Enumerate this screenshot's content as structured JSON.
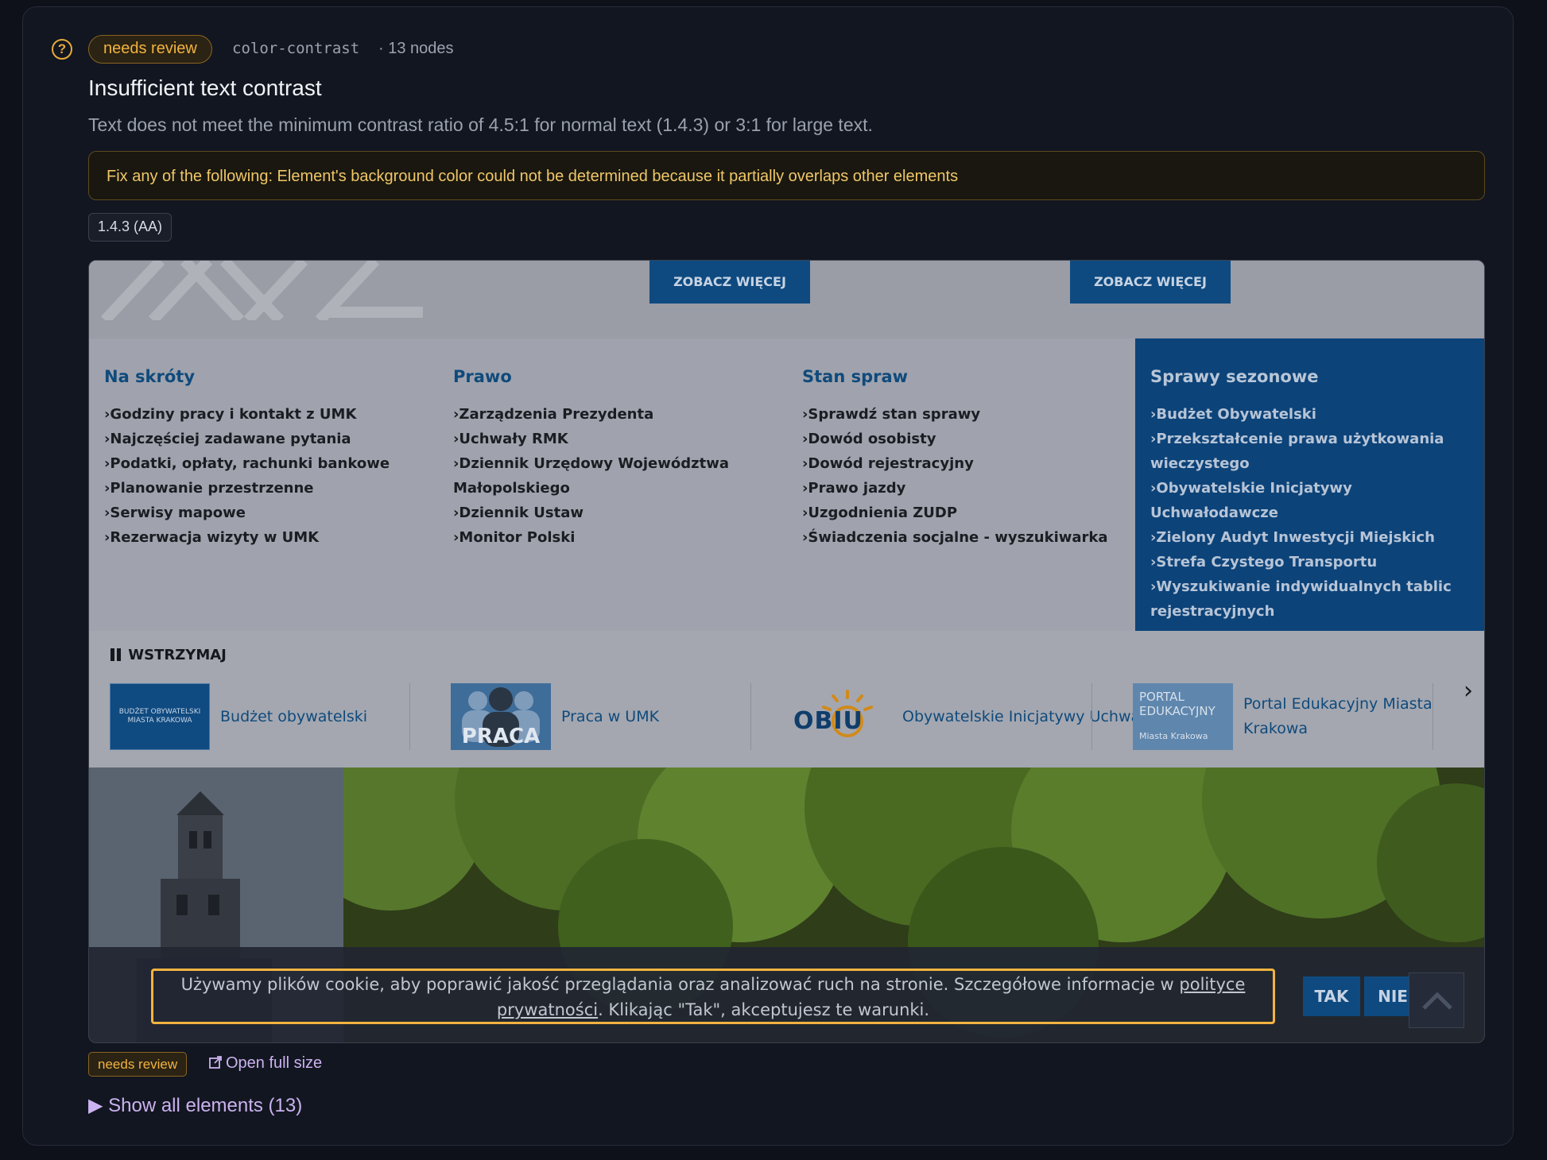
{
  "issue": {
    "status": "needs review",
    "rule_id": "color-contrast",
    "node_count": "· 13 nodes",
    "title": "Insufficient text contrast",
    "description": "Text does not meet the minimum contrast ratio of 4.5:1 for normal text (1.4.3) or 3:1 for large text.",
    "fix_message": "Fix any of the following: Element's background color could not be determined because it partially overlaps other elements",
    "wcag_tag": "1.4.3 (AA)"
  },
  "screenshot": {
    "top_buttons": [
      "ZOBACZ WIĘCEJ",
      "ZOBACZ WIĘCEJ"
    ],
    "columns": [
      {
        "heading": "Na skróty",
        "items": [
          "Godziny pracy i kontakt z UMK",
          "Najczęściej zadawane pytania",
          "Podatki, opłaty, rachunki bankowe",
          "Planowanie przestrzenne",
          "Serwisy mapowe",
          "Rezerwacja wizyty w UMK"
        ]
      },
      {
        "heading": "Prawo",
        "items": [
          "Zarządzenia Prezydenta",
          "Uchwały RMK",
          "Dziennik Urzędowy Województwa Małopolskiego",
          "Dziennik Ustaw",
          "Monitor Polski"
        ]
      },
      {
        "heading": "Stan spraw",
        "items": [
          "Sprawdź stan sprawy",
          "Dowód osobisty",
          "Dowód rejestracyjny",
          "Prawo jazdy",
          "Uzgodnienia ZUDP",
          "Świadczenia socjalne - wyszukiwarka"
        ]
      }
    ],
    "seasonal": {
      "heading": "Sprawy sezonowe",
      "items": [
        "Budżet Obywatelski",
        "Przekształcenie prawa użytkowania wieczystego",
        "Obywatelskie Inicjatywy Uchwałodawcze",
        "Zielony Audyt Inwestycji Miejskich",
        "Strefa Czystego Transportu",
        "Wyszukiwanie indywidualnych tablic rejestracyjnych"
      ]
    },
    "carousel": {
      "pause_label": "WSTRZYMAJ",
      "items": [
        {
          "label": "Budżet obywatelski",
          "thumb_text": "BUDŻET OBYWATELSKI MIASTA KRAKOWA"
        },
        {
          "label": "Praca w UMK",
          "thumb_text": "PRACA"
        },
        {
          "label": "Obywatelskie Inicjatywy Uchwałodawcze",
          "thumb_text": "OBIU"
        },
        {
          "label": "Portal Edukacyjny Miasta Krakowa",
          "thumb_text": "PORTAL EDUKACYJNY",
          "thumb_sub": "Miasta Krakowa"
        }
      ]
    },
    "cookie": {
      "text_before": "Używamy plików cookie, aby poprawić jakość przeglądania oraz analizować ruch na stronie. Szczegółowe informacje w ",
      "link": "polityce prywatności",
      "text_after": ". Klikając \"Tak\", akceptujesz te warunki.",
      "yes": "TAK",
      "no": "NIE"
    }
  },
  "footer": {
    "status": "needs review",
    "open_full": "Open full size",
    "show_all": "▶ Show all elements (13)"
  },
  "colors": {
    "accent": "#f2b340",
    "link": "#cbb2f0",
    "site_blue": "#0e4a80"
  }
}
